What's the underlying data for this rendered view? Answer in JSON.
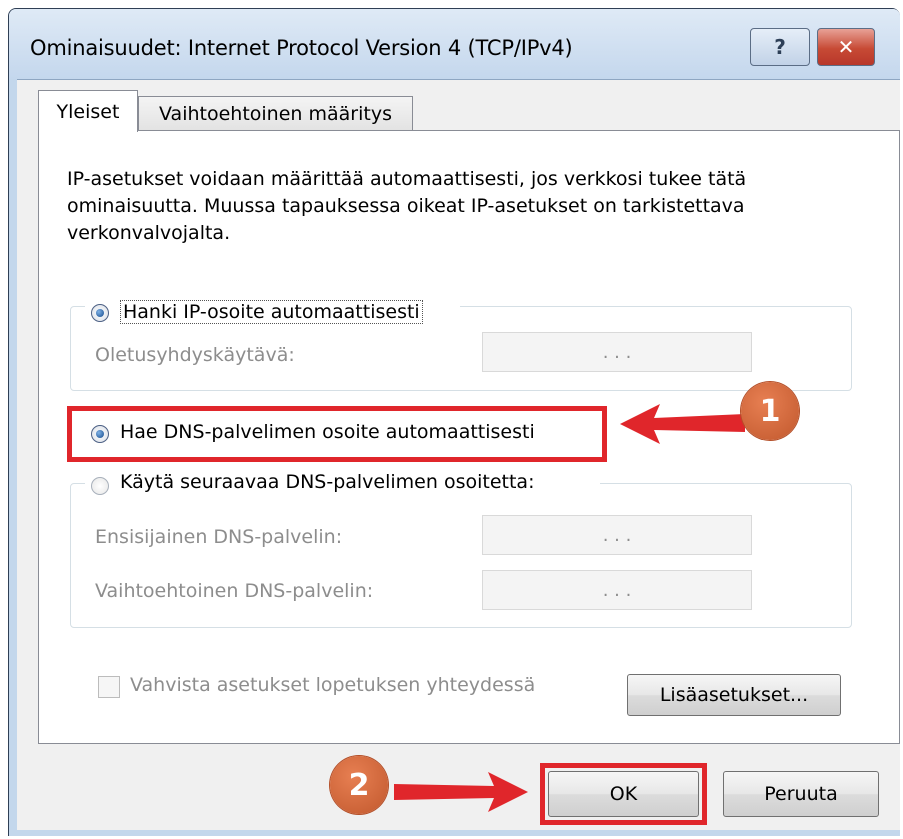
{
  "window": {
    "title": "Ominaisuudet: Internet Protocol Version 4 (TCP/IPv4)",
    "help_label": "?",
    "close_label": "✕"
  },
  "tabs": [
    {
      "label": "Yleiset",
      "active": true
    },
    {
      "label": "Vaihtoehtoinen määritys",
      "active": false
    }
  ],
  "description": "IP-asetukset voidaan määrittää automaattisesti, jos verkkosi tukee tätä ominaisuutta. Muussa tapauksessa oikeat IP-asetukset on tarkistettava verkonvalvojalta.",
  "ip_section": {
    "auto_ip_label": "Hanki IP-osoite automaattisesti",
    "gateway_label": "Oletusyhdyskäytävä:",
    "gateway_value": ".   .   ."
  },
  "dns_section": {
    "auto_dns_label": "Hae DNS-palvelimen osoite automaattisesti",
    "manual_dns_label": "Käytä seuraavaa DNS-palvelimen osoitetta:",
    "preferred_label": "Ensisijainen DNS-palvelin:",
    "alternate_label": "Vaihtoehtoinen DNS-palvelin:",
    "preferred_value": ".   .   .",
    "alternate_value": ".   .   ."
  },
  "validate_label": "Vahvista asetukset lopetuksen yhteydessä",
  "advanced_button": "Lisäasetukset...",
  "ok_button": "OK",
  "cancel_button": "Peruuta",
  "annotations": {
    "step1": "1",
    "step2": "2",
    "highlight_color": "#e0262b",
    "badge_color": "#d2683b"
  }
}
